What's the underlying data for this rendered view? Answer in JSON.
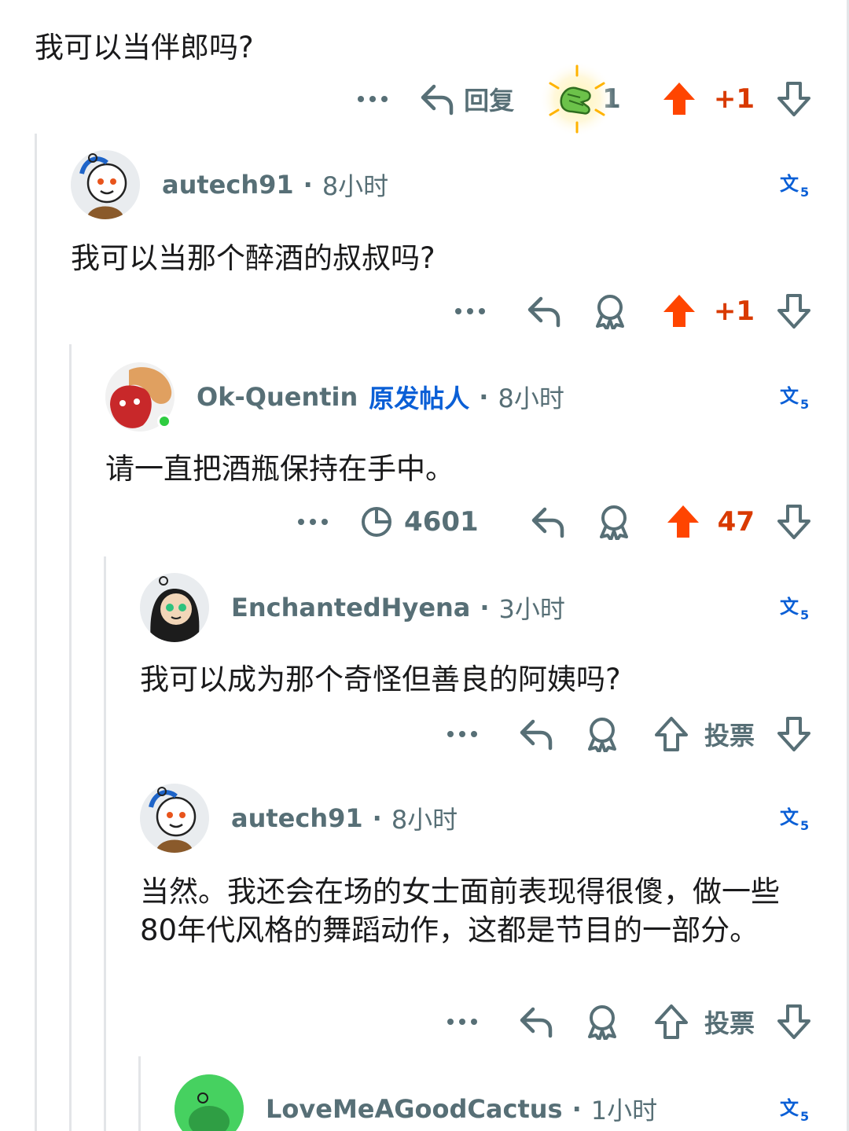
{
  "comments": [
    {
      "text": "我可以当伴郎吗?",
      "actions": {
        "reply_label": "回复",
        "award_count": "1",
        "vote_label": "+1"
      }
    },
    {
      "username": "autech91",
      "time": "8小时",
      "text": "我可以当那个醉酒的叔叔吗?",
      "actions": {
        "vote_label": "+1"
      }
    },
    {
      "username": "Ok-Quentin",
      "op_badge": "原发帖人",
      "time": "8小时",
      "text": "请一直把酒瓶保持在手中。",
      "actions": {
        "views": "4601",
        "vote_label": "47"
      }
    },
    {
      "username": "EnchantedHyena",
      "time": "3小时",
      "text": "我可以成为那个奇怪但善良的阿姨吗?",
      "actions": {
        "vote_label": "投票"
      }
    },
    {
      "username": "autech91",
      "time": "8小时",
      "text": "当然。我还会在场的女士面前表现得很傻，做一些80年代风格的舞蹈动作，这都是节目的一部分。",
      "actions": {
        "vote_label": "投票"
      }
    },
    {
      "username": "LoveMeAGoodCactus",
      "time": "1小时"
    }
  ],
  "icons": {
    "more": "more-icon",
    "reply": "reply-arrow-icon",
    "award": "award-icon",
    "upvote": "upvote-arrow-icon",
    "downvote": "downvote-arrow-icon",
    "translate": "translate-icon",
    "views": "views-clock-icon"
  },
  "colors": {
    "upvote_active": "#ff4500",
    "vote_count_active": "#d93a00",
    "muted": "#576f76",
    "op_badge": "#0a5fd6",
    "online": "#2ecc40"
  }
}
